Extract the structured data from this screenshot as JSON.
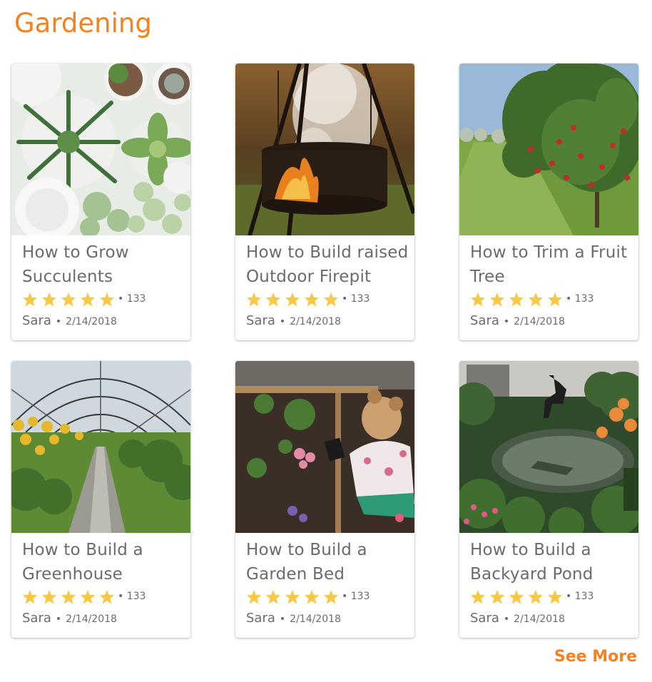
{
  "section": {
    "title": "Gardening"
  },
  "colors": {
    "accent": "#f5821f",
    "star": "#f7c948",
    "text": "#6b6b6b"
  },
  "cards": [
    {
      "title": "How to Grow Succulents",
      "image": "succulents-photo",
      "stars": 5,
      "rating_count": "• 133",
      "author": "Sara",
      "dot": "•",
      "date": "2/14/2018"
    },
    {
      "title": "How to Build raised Outdoor Firepit",
      "image": "firepit-photo",
      "stars": 5,
      "rating_count": "• 133",
      "author": "Sara",
      "dot": "•",
      "date": "2/14/2018"
    },
    {
      "title": "How to Trim a Fruit Tree",
      "image": "fruit-tree-photo",
      "stars": 5,
      "rating_count": "• 133",
      "author": "Sara",
      "dot": "•",
      "date": "2/14/2018"
    },
    {
      "title": "How to Build a Greenhouse",
      "image": "greenhouse-photo",
      "stars": 5,
      "rating_count": "• 133",
      "author": "Sara",
      "dot": "•",
      "date": "2/14/2018"
    },
    {
      "title": "How to Build a Garden Bed",
      "image": "garden-bed-photo",
      "stars": 5,
      "rating_count": "• 133",
      "author": "Sara",
      "dot": "•",
      "date": "2/14/2018"
    },
    {
      "title": "How to Build a Backyard Pond",
      "image": "backyard-pond-photo",
      "stars": 5,
      "rating_count": "• 133",
      "author": "Sara",
      "dot": "•",
      "date": "2/14/2018"
    }
  ],
  "footer": {
    "see_more_label": "See More"
  }
}
